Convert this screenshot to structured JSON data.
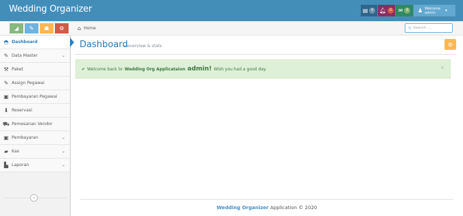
{
  "navbar": {
    "brand": "Wedding Organizer",
    "tasks": {
      "icon": "envelope-icon",
      "count": "0"
    },
    "notifications": {
      "icon": "bell-icon",
      "count": "0"
    },
    "messages": {
      "icon": "envelope-icon",
      "count": "0"
    },
    "user": {
      "icon": "user-icon",
      "welcome": "Welcome",
      "name": "admin"
    }
  },
  "shortcuts": [
    {
      "name": "signal-icon",
      "glyph": "◢",
      "color": "#87b87f"
    },
    {
      "name": "pencil-icon",
      "glyph": "✎",
      "color": "#6fb3e0"
    },
    {
      "name": "users-icon",
      "glyph": "☗",
      "color": "#ffb752"
    },
    {
      "name": "cogs-icon",
      "glyph": "⚙",
      "color": "#d15b47"
    }
  ],
  "sidebar": {
    "items": [
      {
        "label": "Dashboard",
        "icon": "tachometer-icon",
        "glyph": "◓",
        "active": true,
        "has_submenu": false
      },
      {
        "label": "Data Master",
        "icon": "edit-icon",
        "glyph": "✎",
        "has_submenu": true
      },
      {
        "label": "Paket",
        "icon": "gavel-icon",
        "glyph": "⚒",
        "has_submenu": false
      },
      {
        "label": "Assign Pegawai",
        "icon": "edit-icon",
        "glyph": "✎",
        "has_submenu": false
      },
      {
        "label": "Pembayaran Pegawai",
        "icon": "money-icon",
        "glyph": "▣",
        "has_submenu": false
      },
      {
        "label": "Reservasi",
        "icon": "download-icon",
        "glyph": "⬇",
        "has_submenu": false
      },
      {
        "label": "Pemesanan Vendor",
        "icon": "car-icon",
        "glyph": "⛟",
        "has_submenu": false
      },
      {
        "label": "Pembayaran",
        "icon": "money-icon",
        "glyph": "▣",
        "has_submenu": true
      },
      {
        "label": "Kas",
        "icon": "folder-icon",
        "glyph": "▰",
        "has_submenu": true
      },
      {
        "label": "Laporan",
        "icon": "file-icon",
        "glyph": "▙",
        "has_submenu": true
      }
    ],
    "collapse_glyph": "«"
  },
  "breadcrumb": {
    "home": "Home"
  },
  "search": {
    "placeholder": "Search ..."
  },
  "page": {
    "title": "Dashboard",
    "subtitle": "» overview & stats"
  },
  "alert": {
    "prefix": "Welcome back to",
    "app": "Wedding Org Applicataion",
    "user": "admin!",
    "suffix": "Wish you had a good day.",
    "close": "×"
  },
  "footer": {
    "app": "Wedding Organizer",
    "text": "Application © 2020"
  }
}
